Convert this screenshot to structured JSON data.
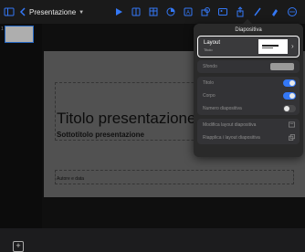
{
  "toolbar": {
    "document_title": "Presentazione",
    "icons": [
      "sidebar-icon",
      "back-chevron-icon",
      "play-icon",
      "slide-grid-icon",
      "table-icon",
      "chart-icon",
      "text-icon",
      "shape-icon",
      "media-icon",
      "share-icon",
      "annotate-icon",
      "format-icon",
      "more-icon"
    ]
  },
  "sidebar": {
    "selected_slide": "1"
  },
  "slide": {
    "title": "Titolo presentazione",
    "subtitle": "Sottotitolo presentazione",
    "author": "Autore e data"
  },
  "popover": {
    "title": "Diapositiva",
    "layout": {
      "label": "Layout",
      "value": "Titolo"
    },
    "background_label": "Sfondo",
    "title_toggle_label": "Titolo",
    "body_toggle_label": "Corpo",
    "slide_number_label": "Numero diapositiva",
    "edit_layout_label": "Modifica layout diapositiva",
    "reapply_layout_label": "Riapplica i layout diapositiva",
    "toggles": {
      "title": true,
      "body": true,
      "slide_number": false
    },
    "accent_color": "#3478f6"
  }
}
